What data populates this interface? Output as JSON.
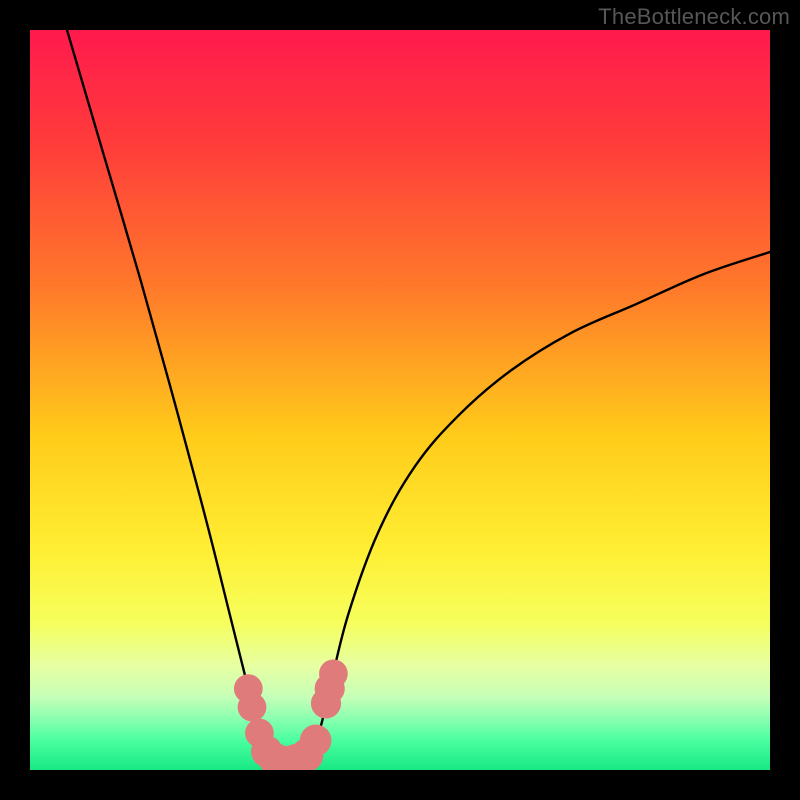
{
  "watermark": "TheBottleneck.com",
  "colors": {
    "background": "#000000",
    "gradient_stops": [
      {
        "offset": 0.0,
        "color": "#ff1a4d"
      },
      {
        "offset": 0.15,
        "color": "#ff3b3b"
      },
      {
        "offset": 0.35,
        "color": "#ff7a2a"
      },
      {
        "offset": 0.55,
        "color": "#ffcc1a"
      },
      {
        "offset": 0.7,
        "color": "#ffee33"
      },
      {
        "offset": 0.8,
        "color": "#f6ff5c"
      },
      {
        "offset": 0.86,
        "color": "#e6ffa3"
      },
      {
        "offset": 0.9,
        "color": "#c7ffb7"
      },
      {
        "offset": 0.93,
        "color": "#8cffb0"
      },
      {
        "offset": 0.96,
        "color": "#4affa0"
      },
      {
        "offset": 1.0,
        "color": "#17e884"
      }
    ],
    "curve": "#000000",
    "marker_fill": "#e07b7b",
    "marker_stroke": "#c96262"
  },
  "chart_data": {
    "type": "line",
    "title": "",
    "xlabel": "",
    "ylabel": "",
    "xlim": [
      0,
      100
    ],
    "ylim": [
      0,
      100
    ],
    "note": "V-shaped bottleneck curve; minimum (≈0) around x≈32–38. Left branch rises steeply toward x=0 (y→100). Right branch rises more gradually toward x=100 (y≈70).",
    "series": [
      {
        "name": "bottleneck-curve",
        "x": [
          5,
          10,
          15,
          20,
          24,
          27,
          29.5,
          31,
          33,
          35,
          37,
          39,
          40.5,
          43,
          47,
          52,
          58,
          65,
          73,
          82,
          91,
          100
        ],
        "y": [
          100,
          83,
          66,
          48,
          33,
          21,
          11,
          5,
          1.5,
          0.8,
          1.5,
          5,
          11,
          21,
          32,
          41,
          48,
          54,
          59,
          63,
          67,
          70
        ]
      }
    ],
    "markers": {
      "name": "highlight-dots",
      "note": "Small salmon-colored dots and short blobs clustered on both sides of the trough near the bottom.",
      "points": [
        {
          "x": 29.5,
          "y": 11,
          "r": 1.4
        },
        {
          "x": 30.0,
          "y": 8.5,
          "r": 1.4
        },
        {
          "x": 31.0,
          "y": 5.0,
          "r": 1.4
        },
        {
          "x": 32.0,
          "y": 2.5,
          "r": 1.6
        },
        {
          "x": 33.2,
          "y": 1.4,
          "r": 1.7
        },
        {
          "x": 34.6,
          "y": 0.9,
          "r": 1.8
        },
        {
          "x": 36.0,
          "y": 1.2,
          "r": 1.8
        },
        {
          "x": 37.4,
          "y": 2.0,
          "r": 1.7
        },
        {
          "x": 38.6,
          "y": 4.0,
          "r": 1.6
        },
        {
          "x": 40.0,
          "y": 9.0,
          "r": 1.5
        },
        {
          "x": 40.5,
          "y": 11.0,
          "r": 1.5
        },
        {
          "x": 41.0,
          "y": 13.0,
          "r": 1.4
        }
      ]
    }
  }
}
